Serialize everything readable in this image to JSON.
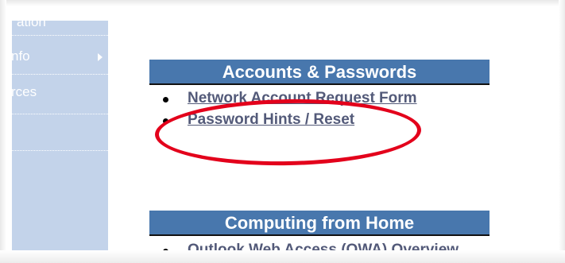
{
  "sidebar": {
    "items": [
      {
        "label": "ation",
        "has_arrow": false
      },
      {
        "label": "nfo",
        "has_arrow": true
      },
      {
        "label": "rces",
        "has_arrow": false
      }
    ]
  },
  "sections": {
    "accounts": {
      "title": "Accounts & Passwords",
      "links": [
        "Network Account Request Form",
        "Password Hints / Reset"
      ]
    },
    "home": {
      "title": "Computing from Home",
      "links": [
        "Outlook Web Access (OWA) Overview"
      ]
    }
  },
  "annotation": {
    "shape": "ellipse",
    "color": "#e3001b",
    "target": "Password Hints / Reset"
  }
}
